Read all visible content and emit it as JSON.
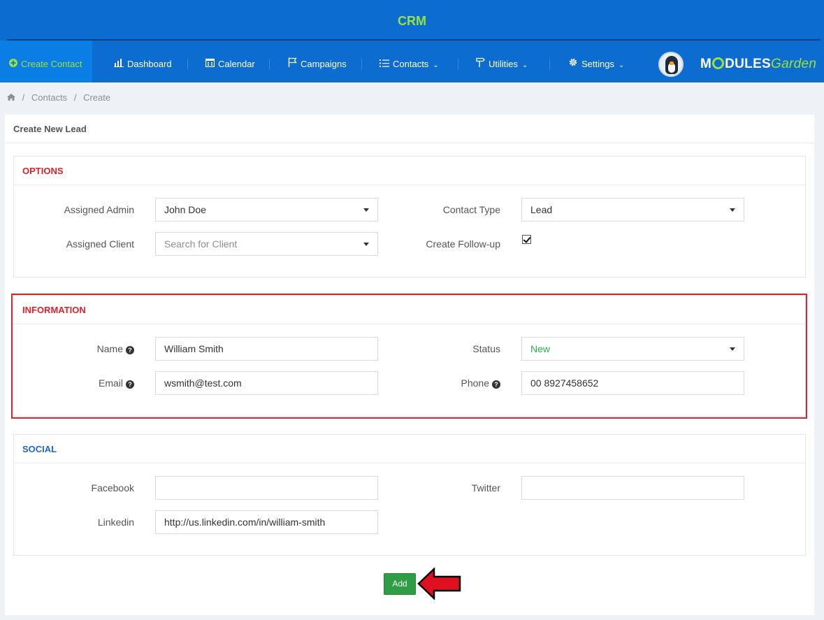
{
  "header": {
    "brand": "CRM",
    "nav": [
      {
        "label": "Create Contact",
        "icon": "plus-circle-icon"
      },
      {
        "label": "Dashboard",
        "icon": "bar-chart-icon"
      },
      {
        "label": "Calendar",
        "icon": "calendar-icon"
      },
      {
        "label": "Campaigns",
        "icon": "flag-icon"
      },
      {
        "label": "Contacts",
        "icon": "list-icon"
      },
      {
        "label": "Utilities",
        "icon": "signpost-icon"
      },
      {
        "label": "Settings",
        "icon": "gear-icon"
      }
    ],
    "logo": {
      "part1": "M",
      "part2": "DULES",
      "part3": "Garden"
    }
  },
  "breadcrumb": {
    "items": [
      "Contacts",
      "Create"
    ],
    "separator": "/"
  },
  "panel": {
    "title": "Create New Lead"
  },
  "options": {
    "title": "OPTIONS",
    "assigned_admin_label": "Assigned Admin",
    "assigned_admin_value": "John Doe",
    "contact_type_label": "Contact Type",
    "contact_type_value": "Lead",
    "assigned_client_label": "Assigned Client",
    "assigned_client_placeholder": "Search for Client",
    "follow_up_label": "Create Follow-up",
    "follow_up_checked": true
  },
  "information": {
    "title": "INFORMATION",
    "name_label": "Name",
    "name_value": "William Smith",
    "status_label": "Status",
    "status_value": "New",
    "email_label": "Email",
    "email_value": "wsmith@test.com",
    "phone_label": "Phone",
    "phone_value": "00 8927458652"
  },
  "social": {
    "title": "SOCIAL",
    "facebook_label": "Facebook",
    "facebook_value": "",
    "twitter_label": "Twitter",
    "twitter_value": "",
    "linkedin_label": "Linkedin",
    "linkedin_value": "http://us.linkedin.com/in/william-smith"
  },
  "actions": {
    "add_label": "Add"
  },
  "colors": {
    "header_bg": "#0c6cd0",
    "accent_green": "#9be23a",
    "section_red": "#d9232d",
    "section_blue": "#1e64d6",
    "button_green": "#2e9e44"
  }
}
